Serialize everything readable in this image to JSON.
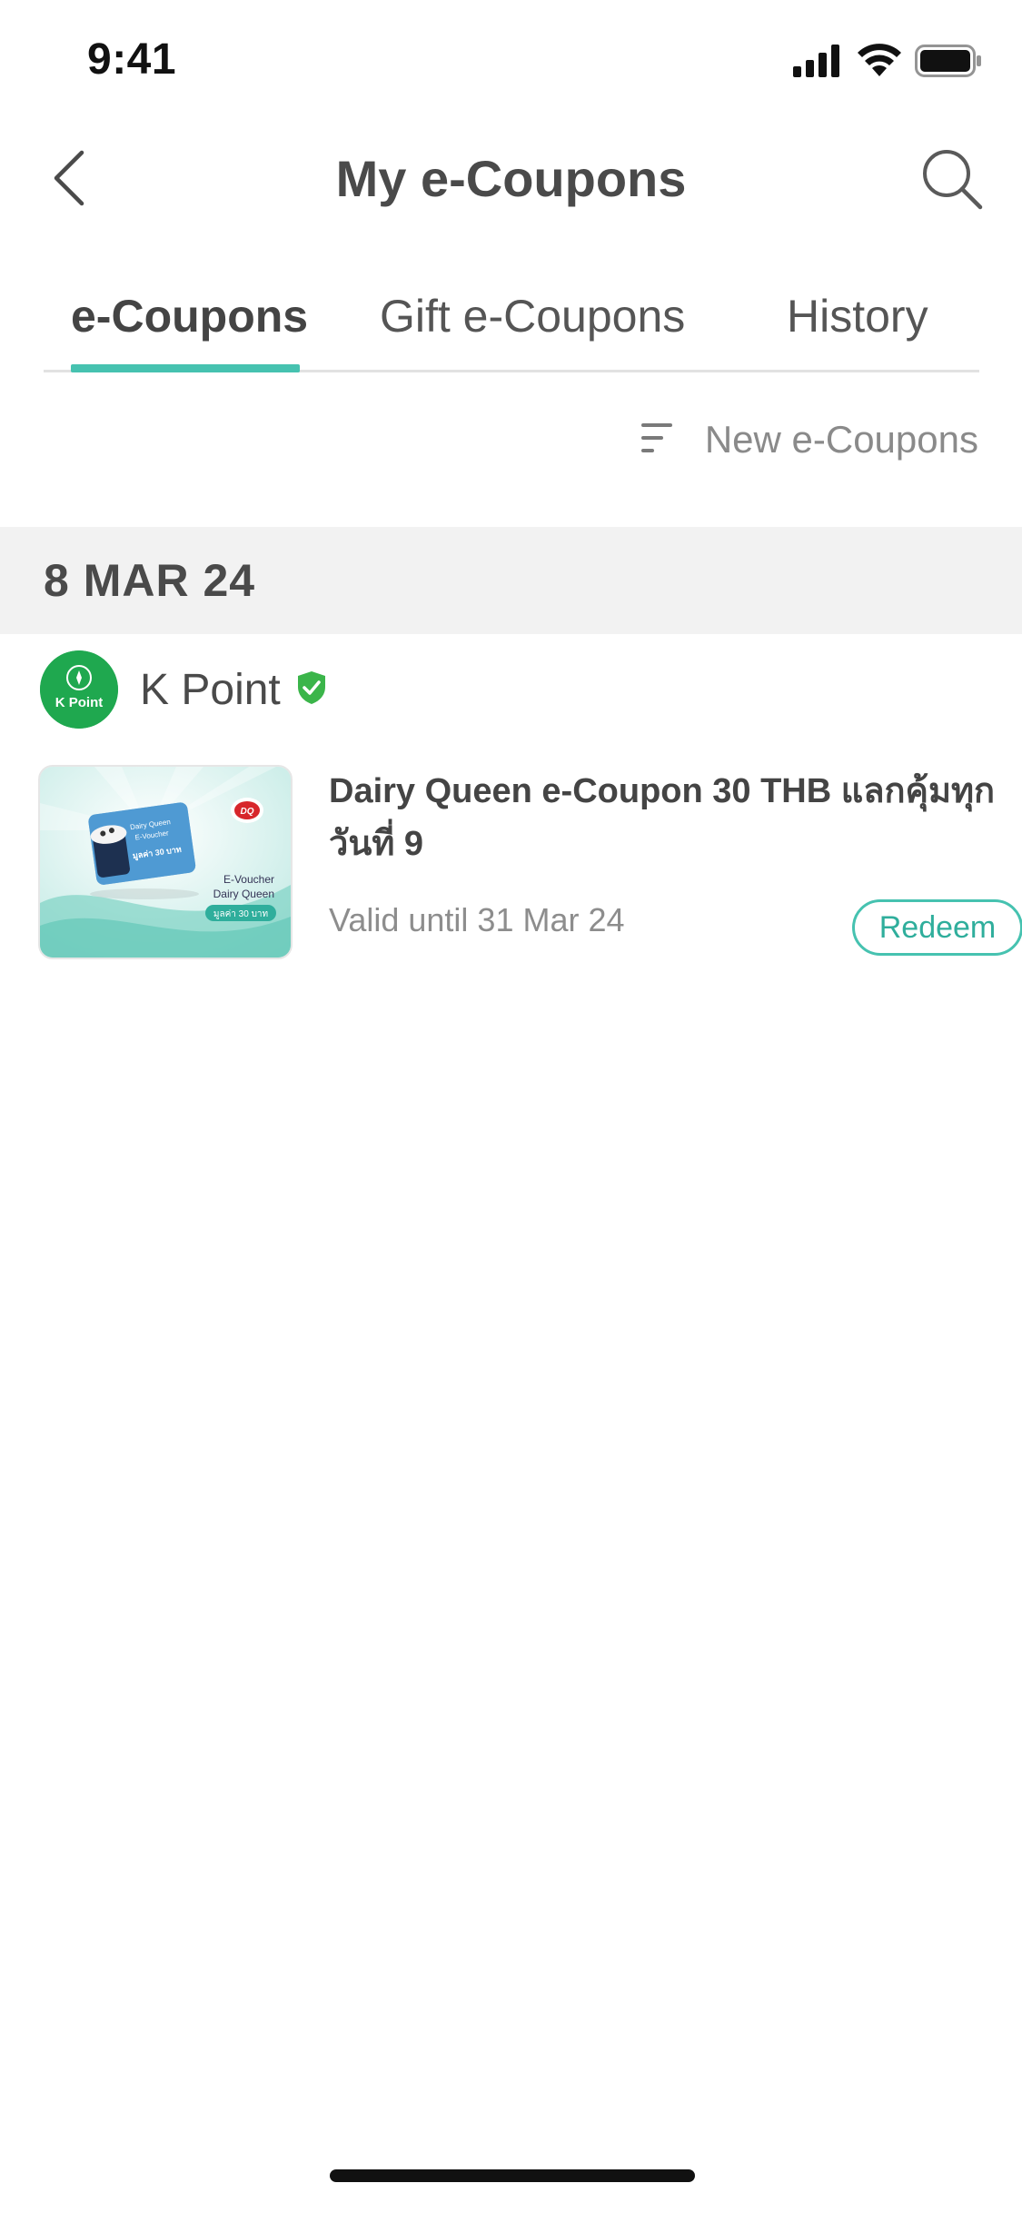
{
  "status_bar": {
    "time": "9:41",
    "icons": [
      "cellular-signal-icon",
      "wifi-icon",
      "battery-icon"
    ]
  },
  "nav": {
    "title": "My e-Coupons",
    "back_icon": "chevron-left-icon",
    "search_icon": "search-icon"
  },
  "tabs": [
    {
      "label": "e-Coupons",
      "active": true
    },
    {
      "label": "Gift e-Coupons",
      "active": false
    },
    {
      "label": "History",
      "active": false
    }
  ],
  "sort": {
    "label": "New e-Coupons",
    "icon": "sort-icon"
  },
  "groups": [
    {
      "date": "8 MAR 24",
      "merchant": {
        "name": "K Point",
        "logo_text": "K Point",
        "verified_icon": "verified-shield-icon"
      },
      "coupon": {
        "title": "Dairy Queen e-Coupon 30 THB แลกคุ้มทุกวันที่ 9",
        "valid": "Valid until 31 Mar 24",
        "redeem_label": "Redeem",
        "thumb": {
          "brand": "DQ",
          "card_line1": "Dairy Queen",
          "card_line2": "E-Voucher",
          "card_value": "มูลค่า 30 บาท",
          "label1": "E-Voucher",
          "label2": "Dairy Queen",
          "badge": "มูลค่า 30 บาท"
        }
      }
    }
  ],
  "colors": {
    "accent": "#46c2b0",
    "date_header_bg": "#f2f2f2",
    "kpoint_green": "#1fa84f",
    "verified_green": "#3bb54a"
  }
}
